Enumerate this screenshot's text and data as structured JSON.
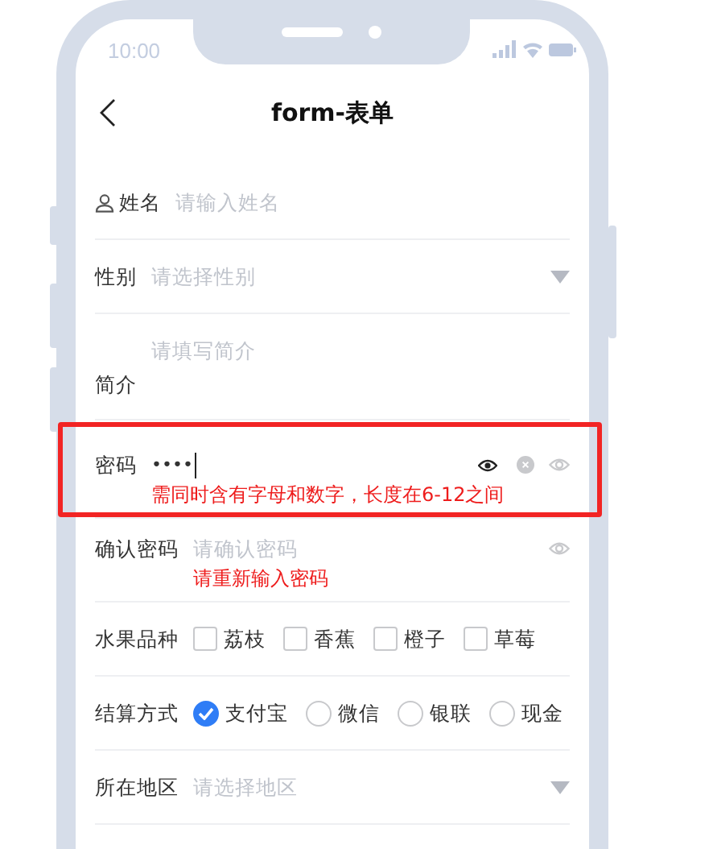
{
  "status_bar": {
    "time": "10:00"
  },
  "header": {
    "title": "form-表单"
  },
  "fields": [
    {
      "kind": "input",
      "label": "姓名",
      "has_icon": true,
      "placeholder": "请输入姓名"
    },
    {
      "kind": "select",
      "label": "性别",
      "placeholder": "请选择性别"
    },
    {
      "kind": "textarea",
      "label": "简介",
      "placeholder": "请填写简介"
    },
    {
      "kind": "password",
      "label": "密码",
      "value": "••••",
      "focused": true,
      "native_reveal": true,
      "clearable": true,
      "error": "需同时含有字母和数字，长度在6-12之间",
      "highlighted": true
    },
    {
      "kind": "password",
      "label": "确认密码",
      "placeholder": "请确认密码",
      "focused": false,
      "error": "请重新输入密码"
    },
    {
      "kind": "checkbox",
      "label": "水果品种",
      "options": [
        {
          "label": "荔枝",
          "checked": false
        },
        {
          "label": "香蕉",
          "checked": false
        },
        {
          "label": "橙子",
          "checked": false
        },
        {
          "label": "草莓",
          "checked": false
        }
      ]
    },
    {
      "kind": "radio",
      "label": "结算方式",
      "options": [
        {
          "label": "支付宝",
          "selected": true
        },
        {
          "label": "微信",
          "selected": false
        },
        {
          "label": "银联",
          "selected": false
        },
        {
          "label": "现金",
          "selected": false
        }
      ]
    },
    {
      "kind": "select",
      "label": "所在地区",
      "placeholder": "请选择地区"
    }
  ]
}
